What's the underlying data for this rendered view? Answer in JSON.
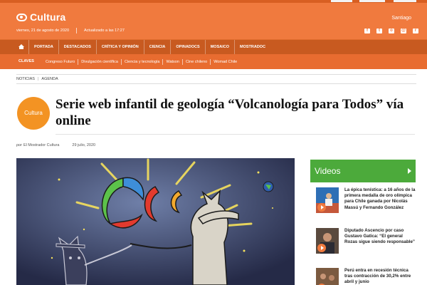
{
  "header": {
    "brand": "Cultura",
    "date": "viernes, 21 de agosto de 2020",
    "updated": "Actualizado a las 17:27",
    "city": "Santiago",
    "social_icons": [
      "facebook-icon",
      "twitter-icon",
      "instagram-icon",
      "mail-icon",
      "rss-icon"
    ]
  },
  "nav_primary": [
    "PORTADA",
    "DESTACADOS",
    "CRÍTICA Y OPINIÓN",
    "CIENCIA",
    "OPINADOCS",
    "MOSAICO",
    "MOSTRADOC"
  ],
  "nav_secondary": {
    "label": "CLAVES",
    "items": [
      "Congreso Futuro",
      "Divulgación científica",
      "Ciencia y tecnología",
      "Watson",
      "Cine chileno",
      "Womad Chile"
    ]
  },
  "breadcrumb": [
    "NOTICIAS",
    "AGENDA"
  ],
  "article": {
    "section_badge": "Cultura",
    "title": "Serie web infantil de geología “Volcanología para Todos” vía online",
    "byline_prefix": "por",
    "author": "El Mostrador Cultura",
    "date": "29 julio, 2020"
  },
  "videos": {
    "heading": "Videos",
    "items": [
      {
        "title": "La épica tenística: a 16 años de la primera medalla de oro olímpica para Chile ganada por Nicolás Massú y Fernando González"
      },
      {
        "title": "Diputado Ascencio por caso Gustavo Gatica: “El general Rozas sigue siendo responsable”"
      },
      {
        "title": "Perú entra en recesión técnica tras contracción de 30,2% entre abril y junio"
      }
    ]
  },
  "colors": {
    "header_orange": "#f07a3e",
    "nav_dark": "#c85a20",
    "videos_green": "#4caa3b",
    "badge_orange": "#f39323"
  }
}
